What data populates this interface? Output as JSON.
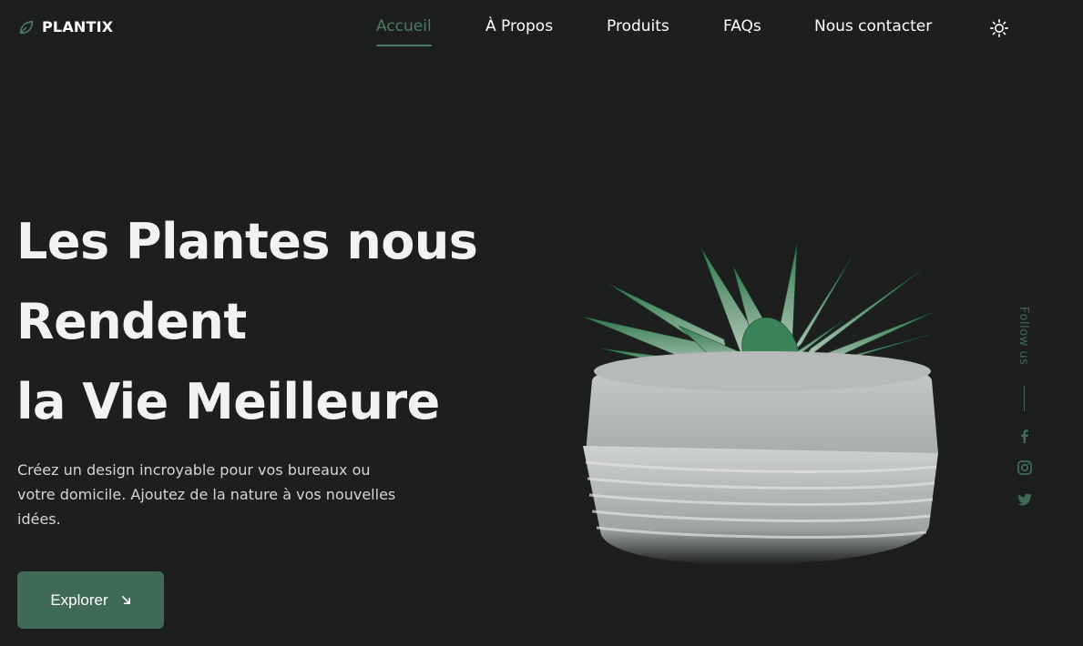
{
  "brand": {
    "name": "PLANTIX",
    "icon": "leaf-icon"
  },
  "nav": {
    "items": [
      {
        "label": "Accueil",
        "active": true
      },
      {
        "label": "À Propos",
        "active": false
      },
      {
        "label": "Produits",
        "active": false
      },
      {
        "label": "FAQs",
        "active": false
      },
      {
        "label": "Nous contacter",
        "active": false
      }
    ],
    "theme_icon": "sun-icon"
  },
  "hero": {
    "title_lines": [
      "Les Plantes nous",
      "Rendent",
      "la Vie Meilleure"
    ],
    "description": "Créez un design incroyable pour vos bureaux ou votre domicile. Ajoutez de la nature à vos nouvelles idées.",
    "cta_label": "Explorer",
    "cta_icon": "arrow-down-right-icon"
  },
  "social": {
    "label": "Follow us",
    "icons": [
      "facebook-icon",
      "instagram-icon",
      "twitter-icon"
    ]
  },
  "colors": {
    "background": "#1c1f1e",
    "accent": "#3f6a55",
    "active_nav": "#4e7a63"
  }
}
